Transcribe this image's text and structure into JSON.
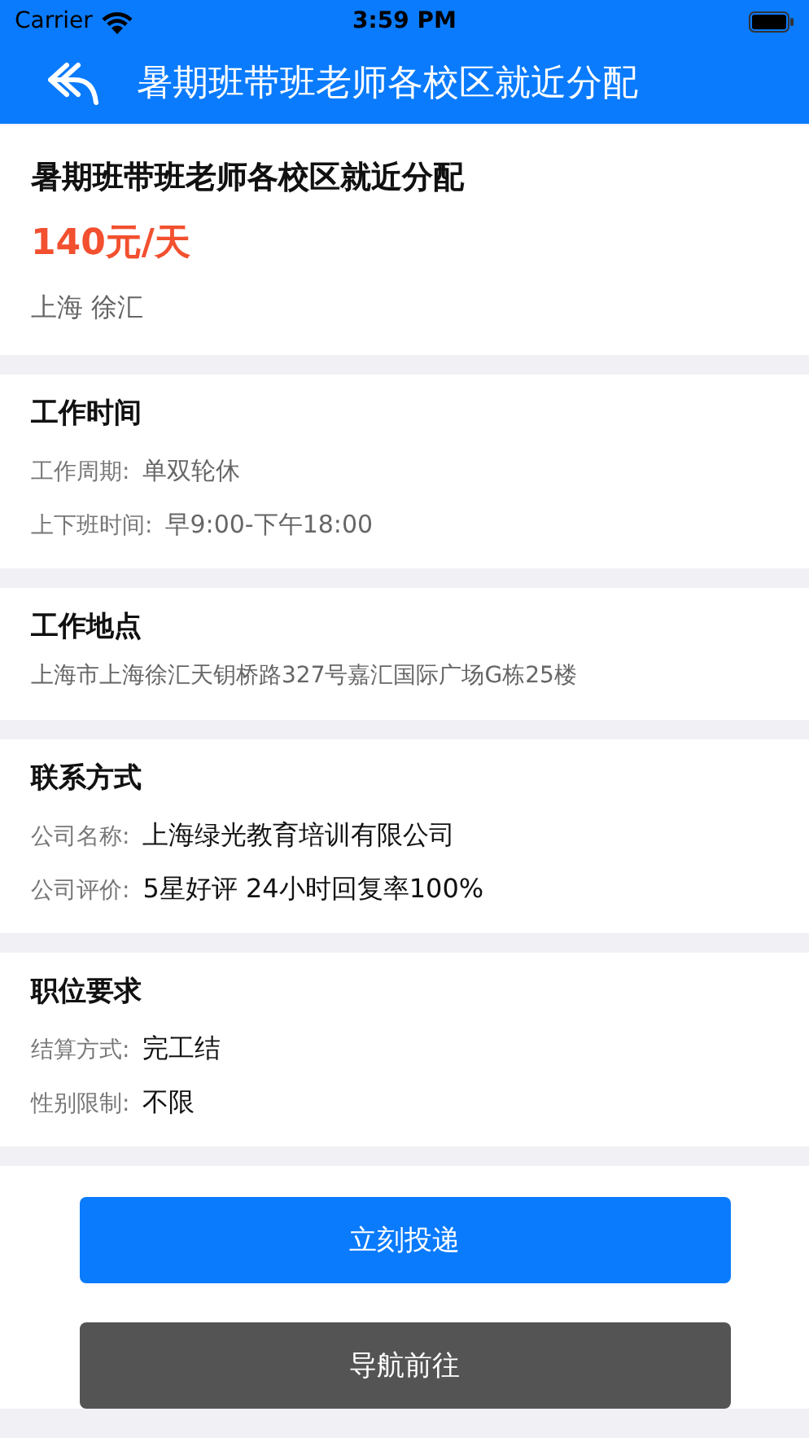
{
  "status_bar": {
    "carrier": "Carrier",
    "time": "3:59 PM"
  },
  "nav_bar": {
    "title": "暑期班带班老师各校区就近分配"
  },
  "job": {
    "title": "暑期班带班老师各校区就近分配",
    "salary": "140元/天",
    "location": "上海 徐汇"
  },
  "sections": [
    {
      "kind": "rows",
      "heading": "工作时间",
      "rows": [
        {
          "label": "工作周期:",
          "value": "单双轮休",
          "kind": "muted"
        },
        {
          "label": "上下班时间:",
          "value": "早9:00-下午18:00",
          "kind": "muted"
        }
      ]
    },
    {
      "kind": "text",
      "heading": "工作地点",
      "text": "上海市上海徐汇天钥桥路327号嘉汇国际广场G栋25楼"
    },
    {
      "kind": "rows",
      "heading": "联系方式",
      "rows": [
        {
          "label": "公司名称:",
          "value": "上海绿光教育培训有限公司",
          "kind": "strong"
        },
        {
          "label": "公司评价:",
          "value": "5星好评 24小时回复率100%",
          "kind": "strong"
        }
      ]
    },
    {
      "kind": "rows",
      "heading": "职位要求",
      "rows": [
        {
          "label": "结算方式:",
          "value": "完工结",
          "kind": "strong"
        },
        {
          "label": "性别限制:",
          "value": "不限",
          "kind": "strong"
        }
      ]
    }
  ],
  "buttons": [
    {
      "label": "立刻投递",
      "kind": "primary"
    },
    {
      "label": "导航前往",
      "kind": "secondary"
    }
  ]
}
